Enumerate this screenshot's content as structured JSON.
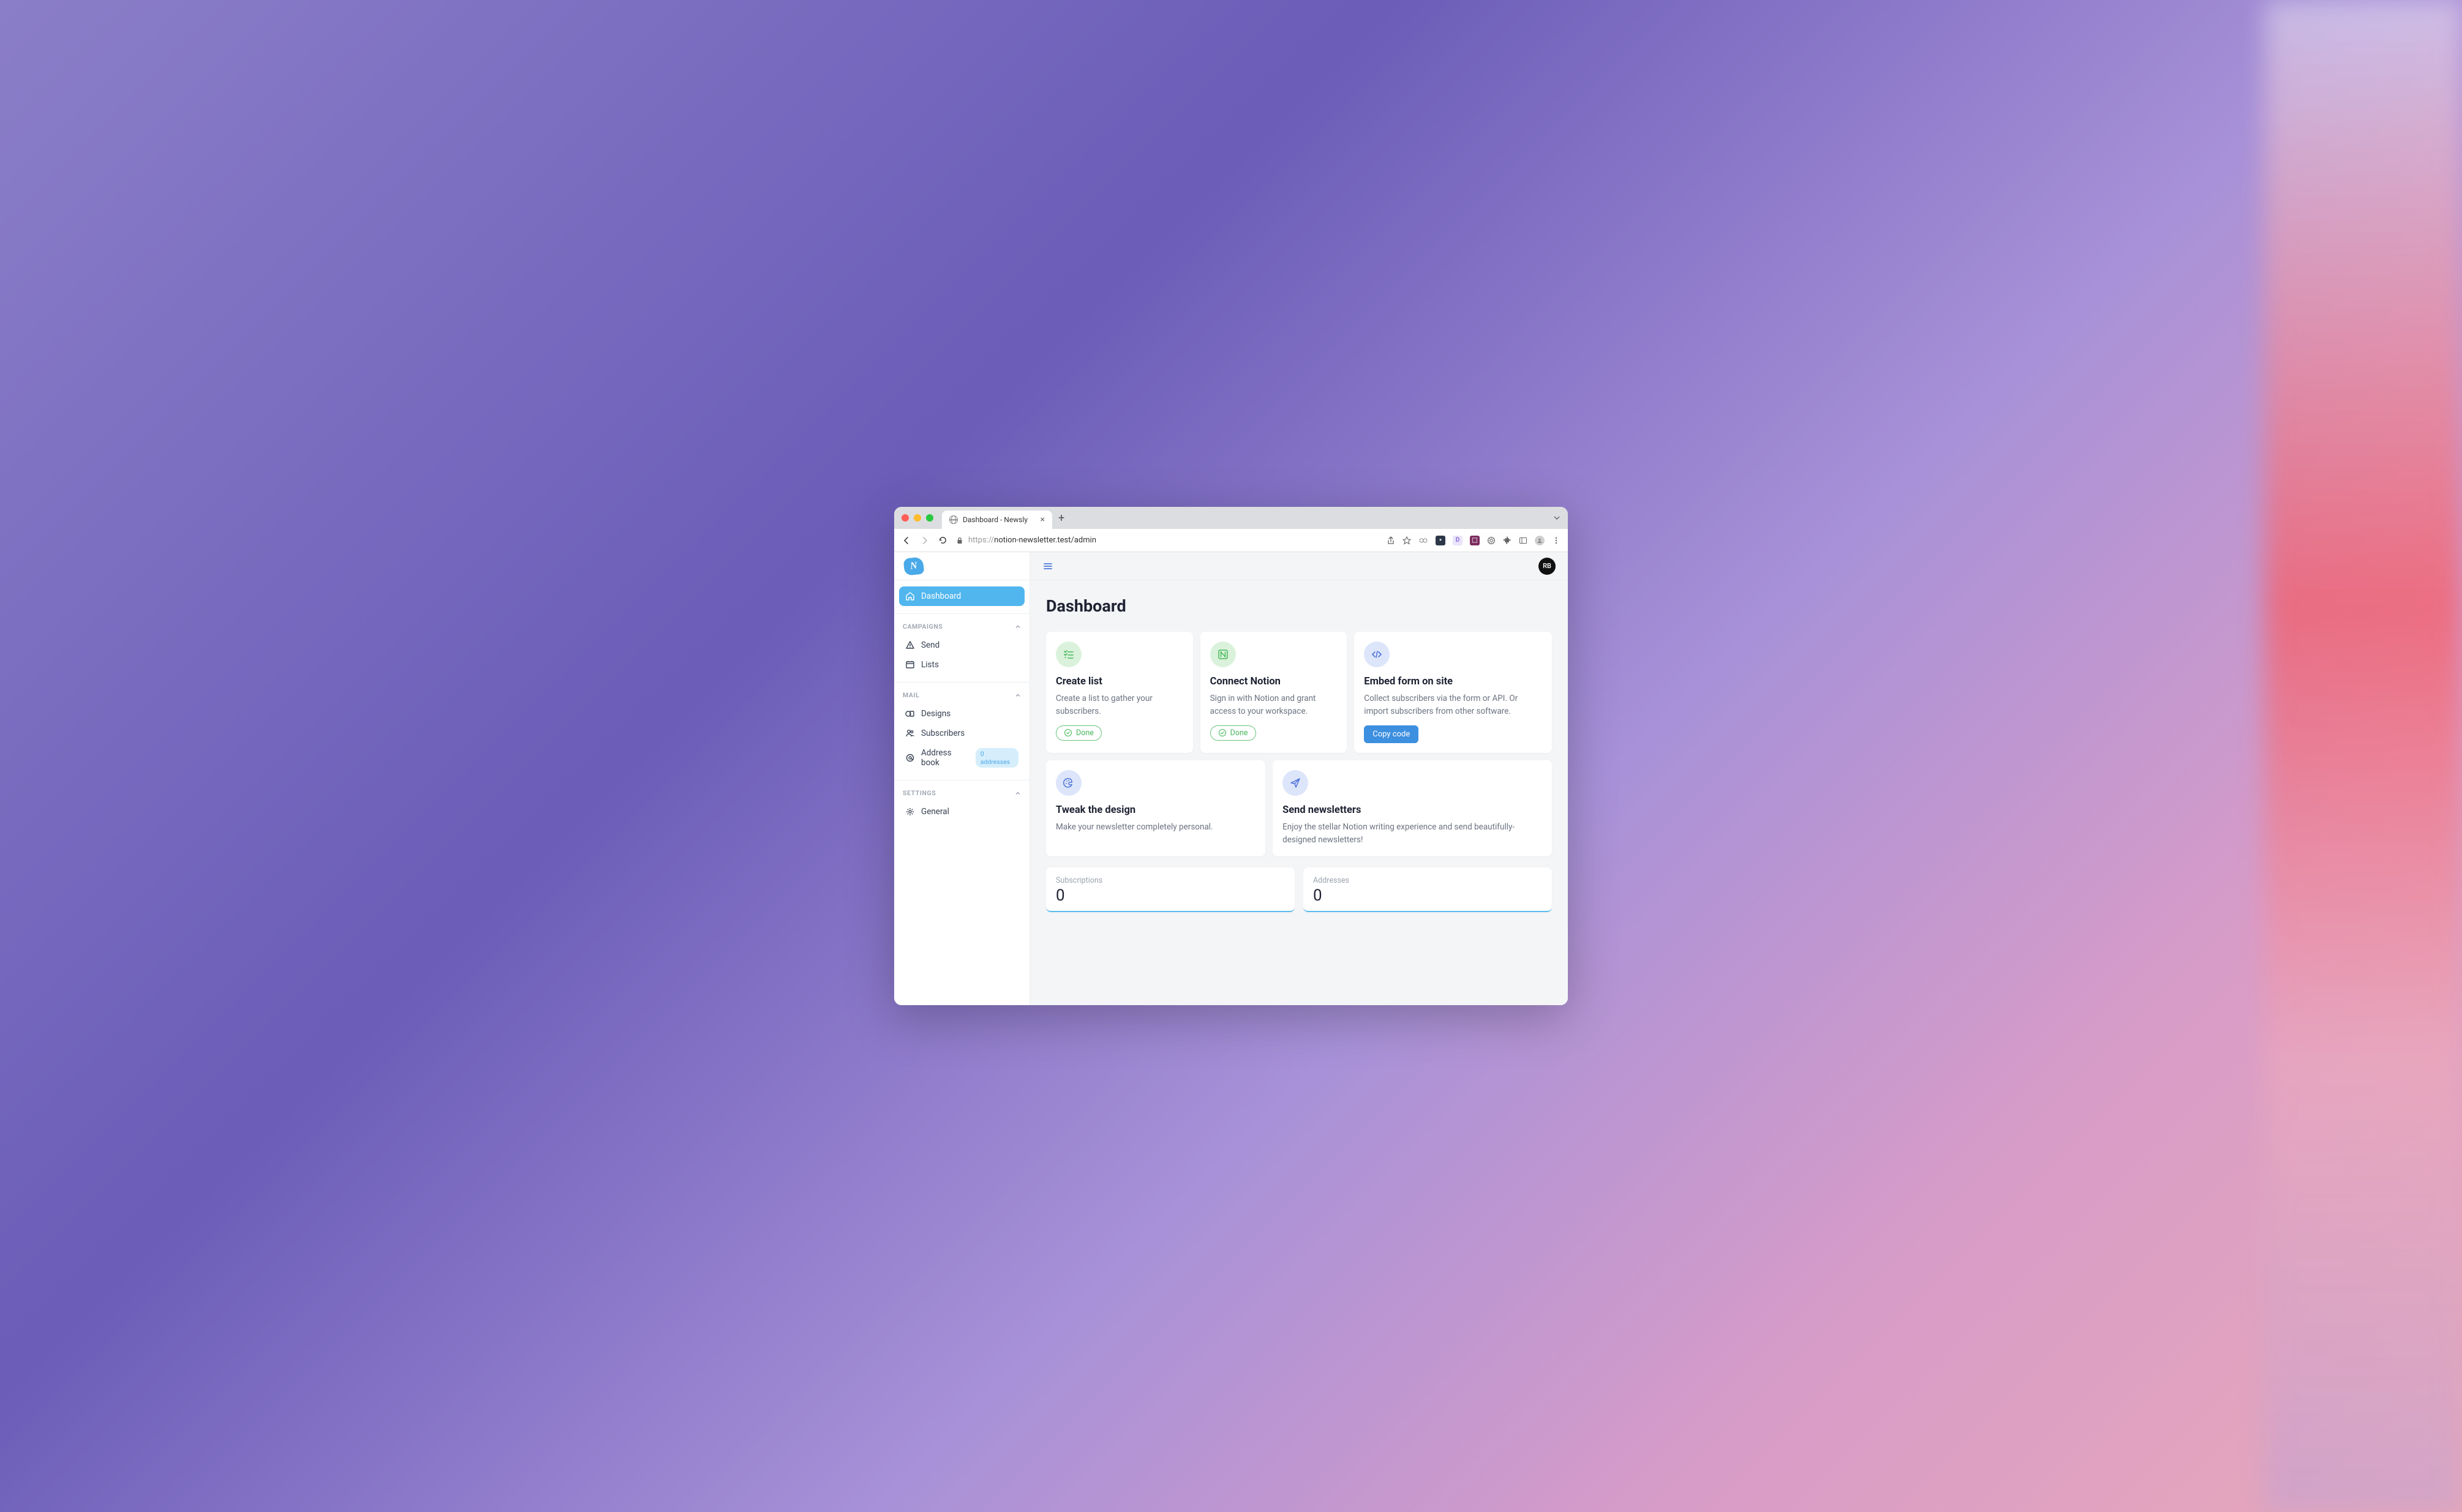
{
  "browser": {
    "tab_title": "Dashboard - Newsly",
    "url_protocol": "https://",
    "url_rest": "notion-newsletter.test/admin"
  },
  "logo_letter": "N",
  "sidebar": {
    "dashboard": "Dashboard",
    "sections": {
      "campaigns": {
        "title": "CAMPAIGNS",
        "send": "Send",
        "lists": "Lists"
      },
      "mail": {
        "title": "MAIL",
        "designs": "Designs",
        "subscribers": "Subscribers",
        "address_book": "Address book",
        "address_badge": "0 addresses"
      },
      "settings": {
        "title": "SETTINGS",
        "general": "General"
      }
    }
  },
  "topbar": {
    "avatar_initials": "RB"
  },
  "page": {
    "title": "Dashboard"
  },
  "cards": {
    "create_list": {
      "title": "Create list",
      "desc": "Create a list to gather your subscribers.",
      "status": "Done"
    },
    "connect_notion": {
      "title": "Connect Notion",
      "desc": "Sign in with Notion and grant access to your workspace.",
      "status": "Done"
    },
    "embed": {
      "title": "Embed form on site",
      "desc": "Collect subscribers via the form or API. Or import subscribers from other software.",
      "button": "Copy code"
    },
    "design": {
      "title": "Tweak the design",
      "desc": "Make your newsletter completely personal."
    },
    "send": {
      "title": "Send newsletters",
      "desc": "Enjoy the stellar Notion writing experience and send beautifully-designed newsletters!"
    }
  },
  "stats": {
    "subscriptions": {
      "label": "Subscriptions",
      "value": "0"
    },
    "addresses": {
      "label": "Addresses",
      "value": "0"
    }
  }
}
